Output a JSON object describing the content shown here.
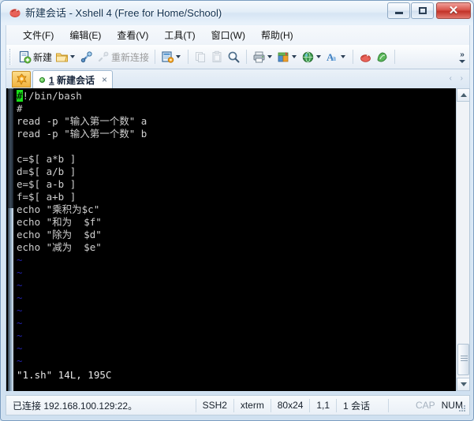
{
  "window": {
    "title": "新建会话 - Xshell 4 (Free for Home/School)",
    "app_icon": "xshell-logo-icon",
    "buttons": {
      "minimize": "minimize-icon",
      "maximize": "maximize-icon",
      "close": "✕"
    }
  },
  "menubar": {
    "items": [
      {
        "label": "文件(F)",
        "name": "menu-file"
      },
      {
        "label": "编辑(E)",
        "name": "menu-edit"
      },
      {
        "label": "查看(V)",
        "name": "menu-view"
      },
      {
        "label": "工具(T)",
        "name": "menu-tools"
      },
      {
        "label": "窗口(W)",
        "name": "menu-window"
      },
      {
        "label": "帮助(H)",
        "name": "menu-help"
      }
    ]
  },
  "toolbar": {
    "new_label": "新建",
    "reconnect_label": "重新连接",
    "overflow_label": "»",
    "items": [
      {
        "name": "new-session-button",
        "icon": "new-document-icon",
        "label": "新建"
      },
      {
        "name": "open-session-button",
        "icon": "open-folder-icon",
        "caret": true
      },
      {
        "name": "connect-button",
        "icon": "plug-connect-icon"
      },
      {
        "name": "reconnect-button",
        "icon": "plug-disconnect-icon",
        "label": "重新连接",
        "disabled": true
      },
      {
        "name": "session-properties-button",
        "icon": "properties-icon",
        "caret": true
      },
      {
        "name": "copy-button",
        "icon": "copy-icon",
        "disabled": true
      },
      {
        "name": "paste-button",
        "icon": "paste-icon",
        "disabled": true
      },
      {
        "name": "find-button",
        "icon": "magnifier-icon"
      },
      {
        "name": "print-button",
        "icon": "printer-icon",
        "caret": true
      },
      {
        "name": "file-transfer-button",
        "icon": "transfer-icon",
        "caret": true
      },
      {
        "name": "web-button",
        "icon": "globe-icon",
        "caret": true
      },
      {
        "name": "font-button",
        "icon": "font-icon",
        "caret": true
      },
      {
        "name": "xshell-button",
        "icon": "xshell-icon"
      },
      {
        "name": "xftp-button",
        "icon": "xftp-icon"
      }
    ]
  },
  "tabstrip": {
    "launcher_icon": "session-launcher-icon",
    "tab": {
      "number": "1",
      "name": "新建会话",
      "status_dot": "connected-green-dot",
      "close": "×"
    },
    "nav_prev": "‹",
    "nav_next": "›"
  },
  "terminal": {
    "rows": [
      {
        "cursor": "#",
        "text": "!/bin/bash"
      },
      {
        "text": "#"
      },
      {
        "text": "read -p \"输入第一个数\" a"
      },
      {
        "text": "read -p \"输入第一个数\" b"
      },
      {
        "text": ""
      },
      {
        "text": "c=$[ a*b ]"
      },
      {
        "text": "d=$[ a/b ]"
      },
      {
        "text": "e=$[ a-b ]"
      },
      {
        "text": "f=$[ a+b ]"
      },
      {
        "text": "echo \"乘积为$c\""
      },
      {
        "text": "echo \"和为  $f\""
      },
      {
        "text": "echo \"除为  $d\""
      },
      {
        "text": "echo \"减为  $e\""
      }
    ],
    "empty_marker": "~",
    "empty_marker_count": 9,
    "status_line": "\"1.sh\" 14L, 195C"
  },
  "statusbar": {
    "connection": "已连接 192.168.100.129:22。",
    "protocol": "SSH2",
    "terminal_type": "xterm",
    "size": "80x24",
    "cursor_pos": "1,1",
    "sessions": "1 会话",
    "cap": "CAP",
    "num": "NUM"
  },
  "colors": {
    "terminal_bg": "#000000",
    "terminal_fg": "#cfcfcf",
    "cursor": "#19e019",
    "tilde": "#2222aa",
    "titlebar_accent": "#12314f",
    "close_button": "#c23328"
  }
}
